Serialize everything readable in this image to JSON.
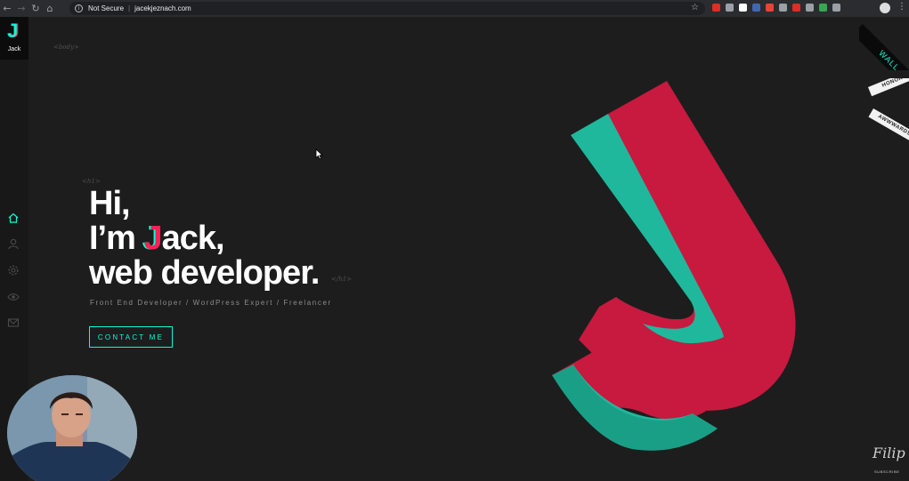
{
  "browser": {
    "security_label": "Not Secure",
    "separator": "|",
    "url": "jacekjeznach.com",
    "extension_colors": [
      "#d93025",
      "#9aa0a6",
      "#ffffff",
      "#4267b2",
      "#ea4335",
      "#9aa0a6",
      "#d93025",
      "#9aa0a6",
      "#34a853",
      "#9aa0a6"
    ]
  },
  "sidebar": {
    "logo_letter": "J",
    "logo_name": "Jack",
    "nav_icons": [
      "home-icon",
      "user-icon",
      "gear-icon",
      "eye-icon",
      "envelope-icon"
    ]
  },
  "tags": {
    "body_open": "<body>",
    "h1_open": "<h1>",
    "h1_close": "</h1>"
  },
  "hero": {
    "line1": "Hi,",
    "line2_prefix": "I’m ",
    "line2_highlight": "J",
    "line2_suffix": "ack,",
    "line3": "web developer.",
    "subtitle": "Front End Developer / WordPress Expert / Freelancer",
    "cta_label": "CONTACT ME"
  },
  "ribbons": {
    "wall": "WALL",
    "honors": "HONORS",
    "awwwards": "AWWWARDS"
  },
  "watermark": {
    "name": "Filip",
    "subscribe": "SUBSCRIBE"
  },
  "colors": {
    "background": "#1d1d1d",
    "accent_teal": "#08fdd8",
    "accent_red": "#fd2155",
    "logo_teal": "#1fb89c",
    "logo_red": "#c8193f"
  }
}
